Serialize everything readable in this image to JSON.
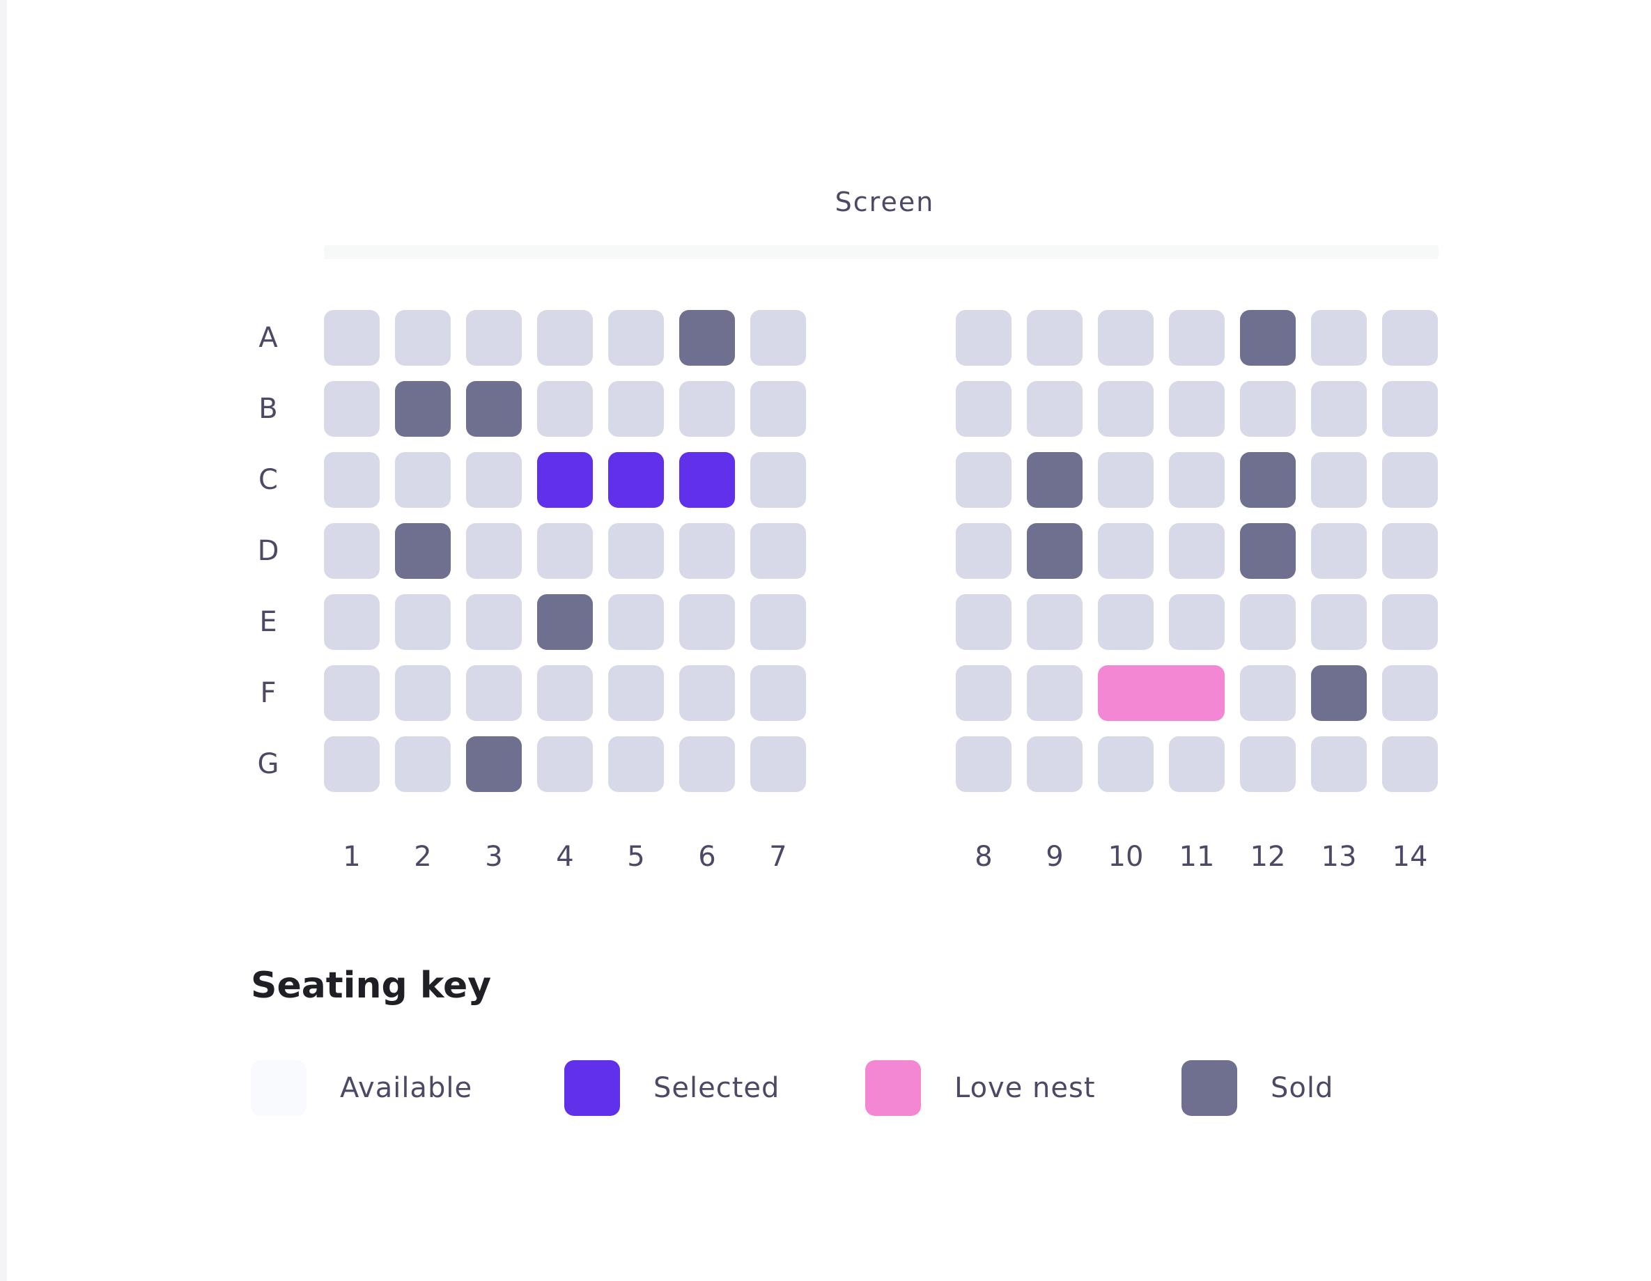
{
  "screen": {
    "label": "Screen"
  },
  "seating": {
    "rows": [
      "A",
      "B",
      "C",
      "D",
      "E",
      "F",
      "G"
    ],
    "left_columns": [
      "1",
      "2",
      "3",
      "4",
      "5",
      "6",
      "7"
    ],
    "right_columns": [
      "8",
      "9",
      "10",
      "11",
      "12",
      "13",
      "14"
    ],
    "left_block": [
      [
        "available",
        "available",
        "available",
        "available",
        "available",
        "sold",
        "available"
      ],
      [
        "available",
        "sold",
        "sold",
        "available",
        "available",
        "available",
        "available"
      ],
      [
        "available",
        "available",
        "available",
        "selected",
        "selected",
        "selected",
        "available"
      ],
      [
        "available",
        "sold",
        "available",
        "available",
        "available",
        "available",
        "available"
      ],
      [
        "available",
        "available",
        "available",
        "sold",
        "available",
        "available",
        "available"
      ],
      [
        "available",
        "available",
        "available",
        "available",
        "available",
        "available",
        "available"
      ],
      [
        "available",
        "available",
        "sold",
        "available",
        "available",
        "available",
        "available"
      ]
    ],
    "right_block": [
      [
        "available",
        "available",
        "available",
        "available",
        "sold",
        "available",
        "available"
      ],
      [
        "available",
        "available",
        "available",
        "available",
        "available",
        "available",
        "available"
      ],
      [
        "available",
        "sold",
        "available",
        "available",
        "sold",
        "available",
        "available"
      ],
      [
        "available",
        "sold",
        "available",
        "available",
        "sold",
        "available",
        "available"
      ],
      [
        "available",
        "available",
        "available",
        "available",
        "available",
        "available",
        "available"
      ],
      [
        "available",
        "available",
        "love",
        "love",
        "available",
        "sold",
        "available"
      ],
      [
        "available",
        "available",
        "available",
        "available",
        "available",
        "available",
        "available"
      ]
    ]
  },
  "key": {
    "title": "Seating key",
    "items": [
      {
        "label": "Available",
        "status": "available",
        "color": "#f9fafe"
      },
      {
        "label": "Selected",
        "status": "selected",
        "color": "#6030ea"
      },
      {
        "label": "Love nest",
        "status": "love",
        "color": "#f487d4"
      },
      {
        "label": "Sold",
        "status": "sold",
        "color": "#6f7090"
      }
    ]
  },
  "colors": {
    "available": "#d8d9e8",
    "selected": "#6030ea",
    "love": "#f487d4",
    "sold": "#6f7090"
  }
}
